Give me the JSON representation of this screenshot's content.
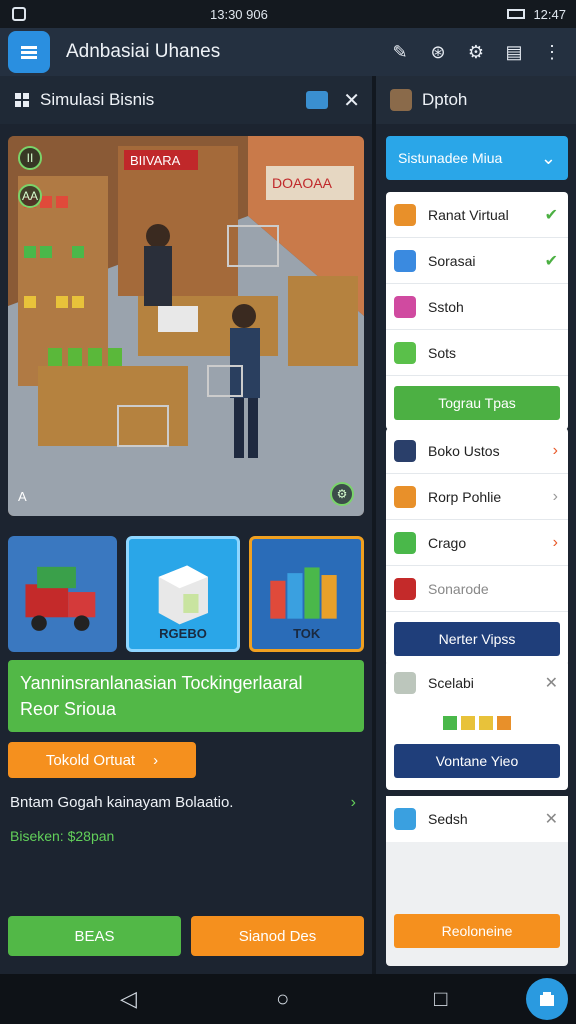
{
  "status": {
    "left_icons": [
      "photo-icon"
    ],
    "center_time": "13:30 906",
    "right_time": "12:47"
  },
  "app": {
    "title": "Adnbasiai Uhanes",
    "actions": [
      "edit-icon",
      "target-icon",
      "settings-icon",
      "share-icon",
      "more-icon"
    ]
  },
  "left_panel": {
    "title": "Simulasi Bisnis",
    "close": "✕"
  },
  "right_panel": {
    "title": "Dptoh"
  },
  "scene": {
    "store_sign_1": "BIIVARA",
    "store_sign_2": "DOAOAA",
    "badge_1": "II",
    "badge_2": "AA",
    "corner_label": "A"
  },
  "tiles": [
    {
      "label": ""
    },
    {
      "label": "RGEBO"
    },
    {
      "label": "TOK"
    }
  ],
  "banner": {
    "line1": "Yanninsranlanasian Tockingerlaaral",
    "line2": "Reor Srioua"
  },
  "cta": {
    "label": "Tokold Ortuat",
    "arrow": "›"
  },
  "description": {
    "text": "Bntam Gogah kainayam Bolaatio.",
    "arrow": "›"
  },
  "price": {
    "text": "Biseken: $28pan"
  },
  "bottom_buttons": {
    "left": "BEAS",
    "right": "Sianod Des"
  },
  "sidebar": {
    "dropdown": "Sistunadee Miua",
    "card1": {
      "rows": [
        {
          "label": "Ranat Virtual",
          "mark": "✔"
        },
        {
          "label": "Sorasai",
          "mark": "✔"
        },
        {
          "label": "Sstoh",
          "mark": ""
        },
        {
          "label": "Sots",
          "mark": ""
        }
      ],
      "button": "Tograu Tpas"
    },
    "card2": {
      "rows": [
        {
          "label": "Boko Ustos",
          "mark": "›"
        },
        {
          "label": "Rorp Pohlie",
          "mark": "›"
        },
        {
          "label": "Crago",
          "mark": "›"
        },
        {
          "label": "Sonarode",
          "mark": ""
        }
      ],
      "button": "Nerter Vipss"
    },
    "card3": {
      "title": "Scelabi",
      "close": "✕",
      "button": "Vontane Yieo"
    },
    "card4": {
      "title": "Sedsh",
      "close": "✕",
      "button": "Reoloneine"
    }
  },
  "colors": {
    "accent": "#2aa6e8",
    "green": "#52b847",
    "orange": "#f5901e",
    "navy": "#1f3e7a"
  }
}
